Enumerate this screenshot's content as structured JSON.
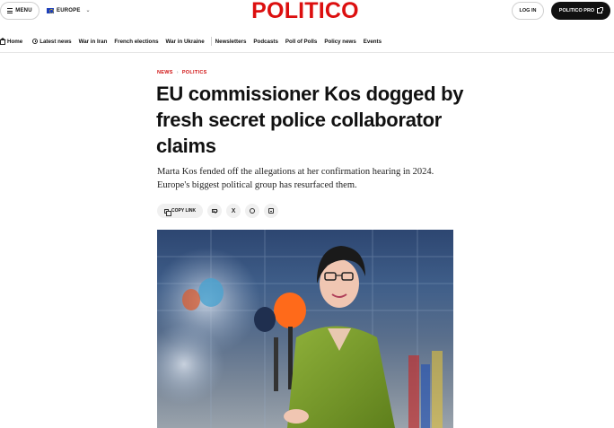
{
  "header": {
    "menu_label": "MENU",
    "edition_label": "EUROPE",
    "logo_text": "POLITICO",
    "login_label": "LOG IN",
    "pro_label": "POLITICO PRO"
  },
  "nav": {
    "items": [
      {
        "label": "Home",
        "icon": "home-icon"
      },
      {
        "label": "Latest news",
        "icon": "clock-icon"
      },
      {
        "label": "War in Iran"
      },
      {
        "label": "French elections"
      },
      {
        "label": "War in Ukraine"
      },
      {
        "label": "Newsletters"
      },
      {
        "label": "Podcasts"
      },
      {
        "label": "Poll of Polls"
      },
      {
        "label": "Policy news"
      },
      {
        "label": "Events"
      }
    ]
  },
  "article": {
    "breadcrumb": [
      "NEWS",
      "POLITICS"
    ],
    "headline": "EU commissioner Kos dogged by fresh secret police collaborator claims",
    "dek": "Marta Kos fended off the allegations at her confirmation hearing in 2024. Europe's biggest political group has resurfaced them.",
    "share": {
      "copy_link_label": "COPY LINK",
      "x_label": "X"
    }
  },
  "colors": {
    "brand_red": "#dc0f0f",
    "breadcrumb_red": "#d01212",
    "pro_button_bg": "#111111"
  }
}
